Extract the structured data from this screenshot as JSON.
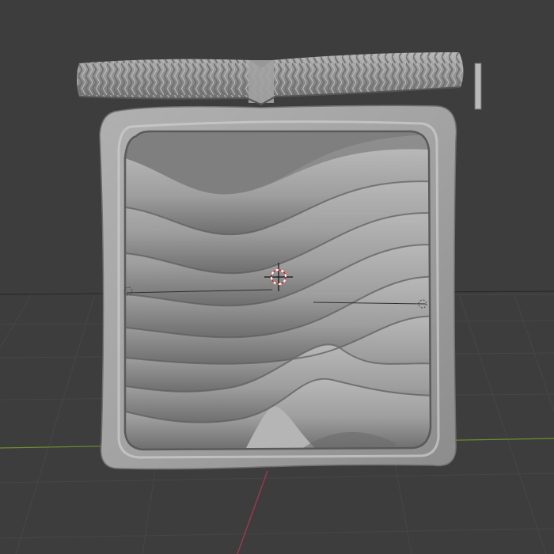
{
  "viewport": {
    "background": "#3d3d3d",
    "grid_color": "#454545",
    "x_axis_color": "#a0384a",
    "y_axis_color": "#6d8f2f",
    "mesh_color": "#9a9a9a",
    "mesh_shadow": "#5f5f5f",
    "mesh_highlight": "#c9c9c9"
  },
  "icons": {
    "cursor": "3d-cursor-icon",
    "empty": "empty-object-icon"
  }
}
